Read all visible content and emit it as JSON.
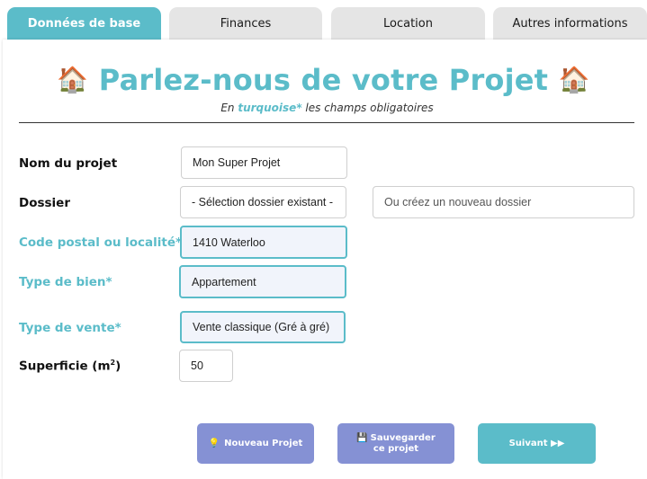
{
  "tabs": [
    {
      "label": "Données de base",
      "active": true
    },
    {
      "label": "Finances",
      "active": false
    },
    {
      "label": "Location",
      "active": false
    },
    {
      "label": "Autres informations",
      "active": false
    }
  ],
  "header": {
    "title": "Parlez-nous de votre Projet",
    "emoji": "🏠",
    "subtitle_prefix": "En ",
    "subtitle_highlight": "turquoise*",
    "subtitle_suffix": " les champs obligatoires"
  },
  "form": {
    "project_name": {
      "label": "Nom du projet",
      "value": "Mon Super Projet"
    },
    "folder": {
      "label": "Dossier",
      "select_value": "- Sélection dossier existant -",
      "new_placeholder": "Ou créez un nouveau dossier"
    },
    "postal": {
      "label": "Code postal ou localité*",
      "value": "1410 Waterloo"
    },
    "property_type": {
      "label": "Type de bien*",
      "value": "Appartement"
    },
    "sale_type": {
      "label": "Type de vente*",
      "value": "Vente classique (Gré à gré)"
    },
    "area": {
      "label_main": "Superficie (m",
      "label_sup": "2",
      "label_end": ")",
      "value": "50"
    }
  },
  "buttons": {
    "new_project": {
      "icon": "💡",
      "label": "Nouveau Projet"
    },
    "save": {
      "icon": "💾",
      "label": "Sauvegarder ce projet"
    },
    "next": {
      "label": "Suivant ▶▶"
    }
  },
  "colors": {
    "accent": "#5bbcc9",
    "secondary": "#8591d4",
    "tab_inactive": "#e5e5e5"
  }
}
